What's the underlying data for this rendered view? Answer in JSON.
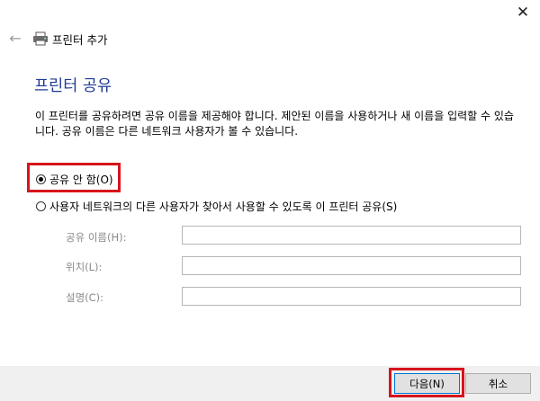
{
  "window": {
    "close_glyph": "✕"
  },
  "header": {
    "back_glyph": "←",
    "icon": "printer-icon",
    "title": "프린터 추가"
  },
  "main": {
    "heading": "프린터 공유",
    "description": "이 프린터를 공유하려면 공유 이름을 제공해야 합니다. 제안된 이름을 사용하거나 새 이름을 입력할 수 있습니다. 공유 이름은 다른 네트워크 사용자가 볼 수 있습니다.",
    "options": [
      {
        "label": "공유 안 함(O)",
        "selected": true
      },
      {
        "label": "사용자 네트워크의 다른 사용자가 찾아서 사용할 수 있도록 이 프린터 공유(S)",
        "selected": false
      }
    ],
    "fields": [
      {
        "label": "공유 이름(H):",
        "value": ""
      },
      {
        "label": "위치(L):",
        "value": ""
      },
      {
        "label": "설명(C):",
        "value": ""
      }
    ]
  },
  "footer": {
    "next_label": "다음(N)",
    "cancel_label": "취소"
  },
  "colors": {
    "highlight": "#d6141c",
    "heading": "#1f3a93",
    "footer_bg": "#f0f0f0"
  }
}
